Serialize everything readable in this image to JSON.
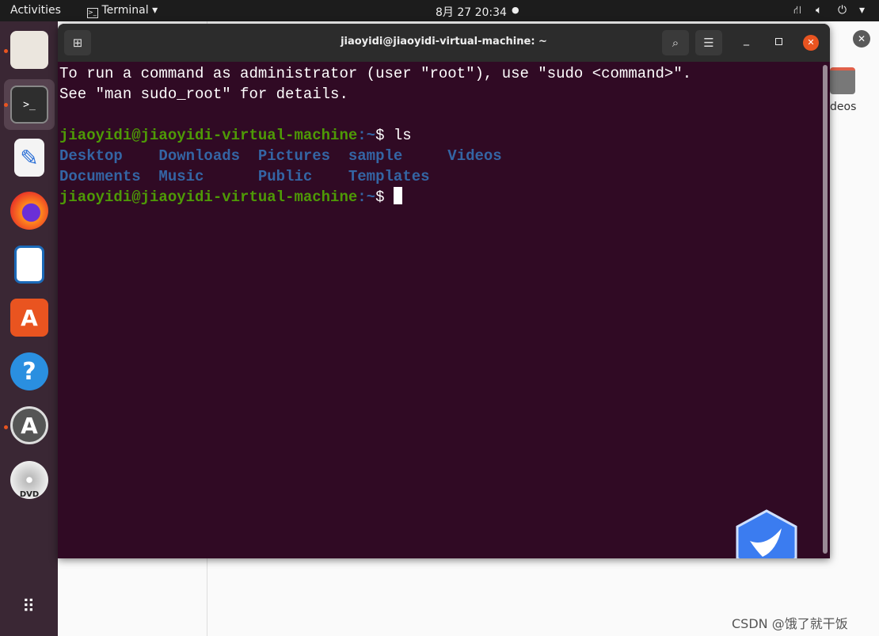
{
  "topbar": {
    "activities": "Activities",
    "app_menu": "Terminal",
    "clock": "8月 27  20:34"
  },
  "dock": {
    "items": [
      "Files",
      "Terminal",
      "Text Editor",
      "Firefox",
      "LibreOffice Writer",
      "Ubuntu Software",
      "Help",
      "Software Updater",
      "DVD"
    ],
    "show_apps": "Show Applications"
  },
  "background_window": {
    "item_label": "deos"
  },
  "terminal": {
    "title": "jiaoyidi@jiaoyidi-virtual-machine: ~",
    "motd": [
      "To run a command as administrator (user \"root\"), use \"sudo <command>\".",
      "See \"man sudo_root\" for details."
    ],
    "prompt_user": "jiaoyidi@jiaoyidi-virtual-machine",
    "prompt_path": ":~",
    "prompt_sym": "$ ",
    "command": "ls",
    "ls_rows": [
      [
        "Desktop    ",
        "Downloads  ",
        "Pictures  ",
        "sample     ",
        "Videos"
      ],
      [
        "Documents  ",
        "Music      ",
        "Public    ",
        "Templates"
      ]
    ]
  },
  "watermark": "CSDN @饿了就干饭",
  "colors": {
    "terminal_bg": "#300a24",
    "prompt": "#4e9a06",
    "directory": "#3465a4",
    "close": "#e95420"
  }
}
